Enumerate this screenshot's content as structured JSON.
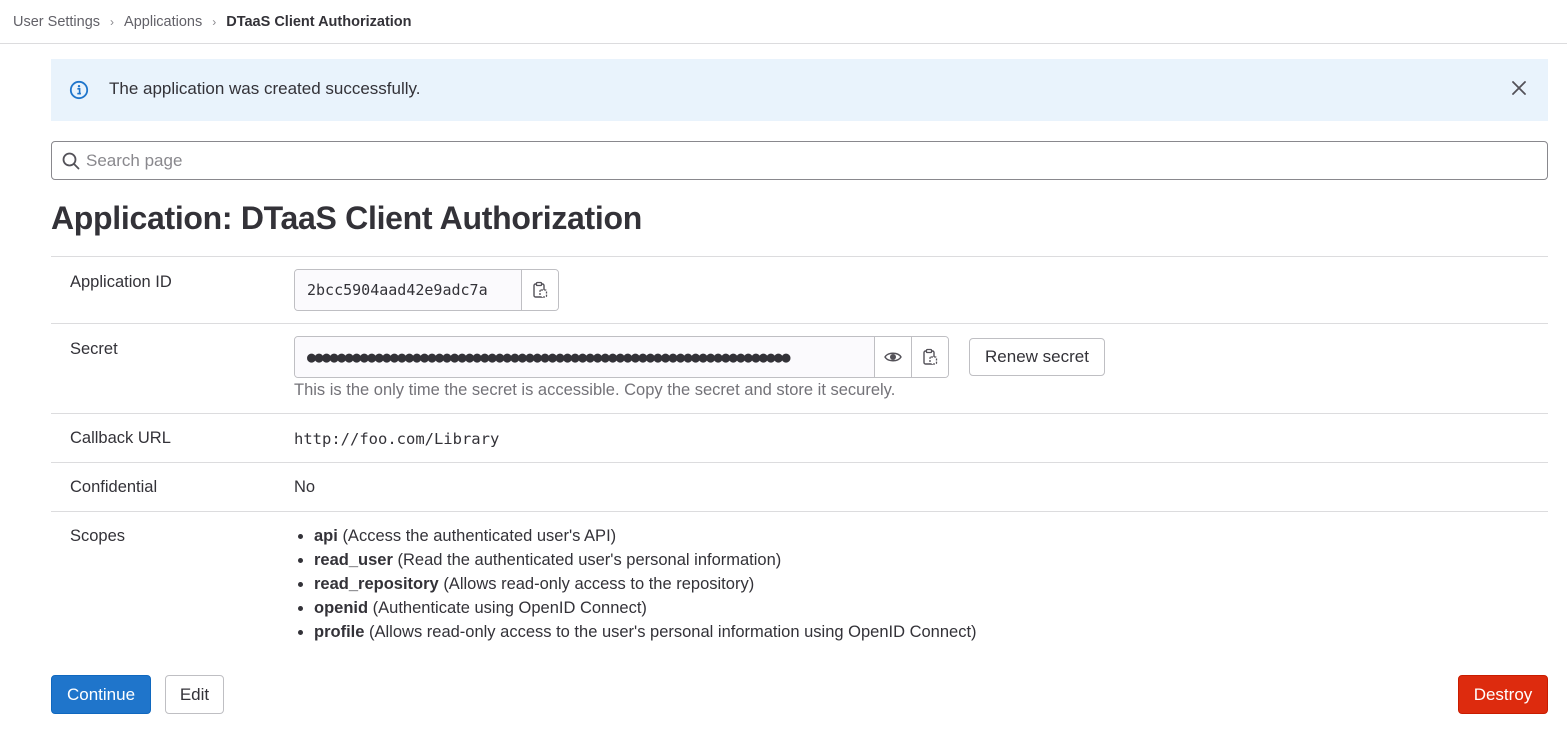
{
  "breadcrumb": {
    "items": [
      {
        "label": "User Settings"
      },
      {
        "label": "Applications"
      },
      {
        "label": "DTaaS Client Authorization"
      }
    ],
    "separator": "›"
  },
  "alert": {
    "message": "The application was created successfully.",
    "icon": "info-icon",
    "close_icon": "close-icon",
    "background": "#e9f3fc"
  },
  "search": {
    "placeholder": "Search page",
    "value": ""
  },
  "page": {
    "title": "Application: DTaaS Client Authorization"
  },
  "details": {
    "application_id": {
      "label": "Application ID",
      "value": "2bcc5904aad42e9adc7a",
      "copy_icon": "clipboard-icon"
    },
    "secret": {
      "label": "Secret",
      "masked_value": "●●●●●●●●●●●●●●●●●●●●●●●●●●●●●●●●●●●●●●●●●●●●●●●●●●●●●●●●●●●●●●●●",
      "reveal_icon": "eye-icon",
      "copy_icon": "clipboard-icon",
      "renew_label": "Renew secret",
      "help_text": "This is the only time the secret is accessible. Copy the secret and store it securely."
    },
    "callback_url": {
      "label": "Callback URL",
      "value": "http://foo.com/Library"
    },
    "confidential": {
      "label": "Confidential",
      "value": "No"
    },
    "scopes": {
      "label": "Scopes",
      "items": [
        {
          "name": "api",
          "description": "(Access the authenticated user's API)"
        },
        {
          "name": "read_user",
          "description": "(Read the authenticated user's personal information)"
        },
        {
          "name": "read_repository",
          "description": "(Allows read-only access to the repository)"
        },
        {
          "name": "openid",
          "description": "(Authenticate using OpenID Connect)"
        },
        {
          "name": "profile",
          "description": "(Allows read-only access to the user's personal information using OpenID Connect)"
        }
      ]
    }
  },
  "actions": {
    "continue_label": "Continue",
    "edit_label": "Edit",
    "destroy_label": "Destroy"
  },
  "colors": {
    "primary": "#1f75cb",
    "danger": "#dd2b0e",
    "info": "#1f75cb"
  }
}
